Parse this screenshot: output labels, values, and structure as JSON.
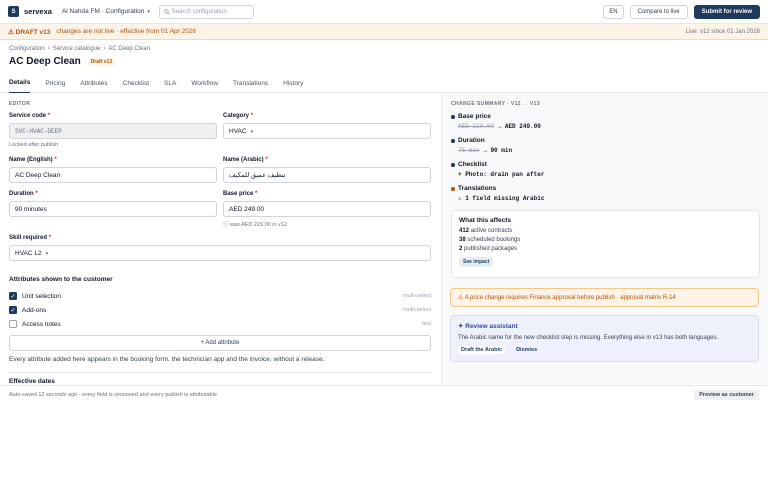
{
  "topbar": {
    "logo_letter": "S",
    "brand": "servexa",
    "org": "Al Nahda FM · Configuration",
    "search_placeholder": "Search configuration",
    "lang": "EN",
    "compare": "Compare to live",
    "submit": "Submit for review"
  },
  "banner": {
    "label": "DRAFT v13",
    "message": "changes are not live · effective from 01 Apr 2026",
    "live": "Live: v12 since 01 Jan 2026"
  },
  "breadcrumb": [
    "Configuration",
    "Service catalogue",
    "AC Deep Clean"
  ],
  "page": {
    "title": "AC Deep Clean",
    "badge": "Draft v13"
  },
  "tabs": [
    "Details",
    "Pricing",
    "Attributes",
    "Checklist",
    "SLA",
    "Workflow",
    "Translations",
    "History"
  ],
  "editor": {
    "section": "EDITOR",
    "service_code": {
      "label": "Service code",
      "value": "SVC-HVAC-DEEP",
      "hint": "Locked after publish"
    },
    "category": {
      "label": "Category",
      "value": "HVAC"
    },
    "name_en": {
      "label": "Name (English)",
      "value": "AC Deep Clean"
    },
    "name_ar": {
      "label": "Name (Arabic)",
      "value": "تنظيف عميق للمكيف"
    },
    "duration": {
      "label": "Duration",
      "value": "90 minutes"
    },
    "price": {
      "label": "Base price",
      "value": "AED 249.00",
      "hint": "was AED 229.00 in v12"
    },
    "skill": {
      "label": "Skill required",
      "value": "HVAC L2"
    },
    "required_mark": "*"
  },
  "attributes": {
    "heading": "Attributes shown to the customer",
    "items": [
      {
        "label": "Unit selection",
        "type": "multi-select",
        "checked": true
      },
      {
        "label": "Add-ons",
        "type": "multi-select",
        "checked": true
      },
      {
        "label": "Access notes",
        "type": "text",
        "checked": false
      }
    ],
    "add_button": "+ Add attribute",
    "note": "Every attribute added here appears in the booking form, the technician app and the invoice, without a release."
  },
  "effective_dates": "Effective dates",
  "footer": {
    "autosave": "Auto-saved 12 seconds ago · every field is versioned and every publish is attributable",
    "preview": "Preview as customer"
  },
  "change_summary": {
    "title": "CHANGE SUMMARY · V12 → V13",
    "changes": [
      {
        "title": "Base price",
        "old": "AED 229.00",
        "arrow": "→",
        "new": "AED 249.00"
      },
      {
        "title": "Duration",
        "old": "75 min",
        "arrow": "→",
        "new": "90 min"
      },
      {
        "title": "Checklist",
        "new": "+ Photo: drain pan after"
      },
      {
        "title": "Translations",
        "warning": "⚠ 1 field missing Arabic"
      }
    ]
  },
  "affects": {
    "heading": "What this affects",
    "lines": [
      {
        "count": "412",
        "text": "active contracts"
      },
      {
        "count": "38",
        "text": "scheduled bookings"
      },
      {
        "count": "2",
        "text": "published packages"
      }
    ],
    "button": "See impact"
  },
  "approval_warning": "⚠ A price change requires Finance approval before publish · approval matrix R-14",
  "assistant": {
    "heading": "✦ Review assistant",
    "message": "The Arabic name for the new checklist step is missing. Everything else in v13 has both languages.",
    "primary": "Draft the Arabic",
    "secondary": "Dismiss"
  }
}
